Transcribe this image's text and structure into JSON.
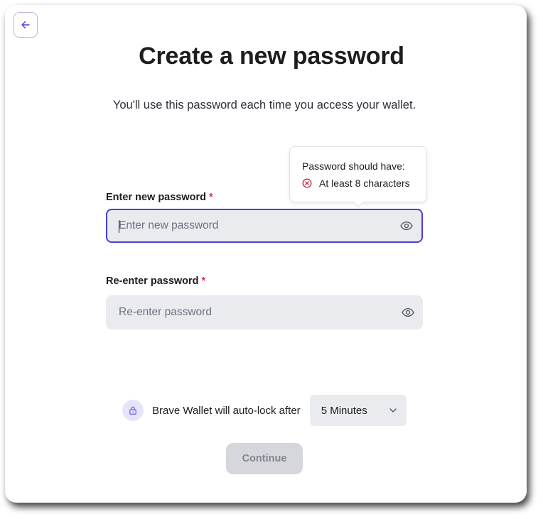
{
  "page": {
    "title": "Create a new password",
    "subtitle": "You'll use this password each time you access your wallet."
  },
  "navigation": {
    "back_icon": "arrow-left-icon"
  },
  "tooltip": {
    "heading": "Password should have:",
    "requirements": [
      {
        "label": "At least 8 characters",
        "status": "unmet",
        "icon": "close-circle-icon"
      }
    ]
  },
  "form": {
    "new_password": {
      "label": "Enter new password",
      "required_mark": "*",
      "placeholder": "Enter new password",
      "value": "",
      "focused": true,
      "toggle_icon": "eye-icon"
    },
    "confirm_password": {
      "label": "Re-enter password",
      "required_mark": "*",
      "placeholder": "Re-enter password",
      "value": "",
      "toggle_icon": "eye-icon"
    }
  },
  "autolock": {
    "icon": "lock-icon",
    "text": "Brave Wallet will auto-lock after",
    "selected": "5 Minutes",
    "dropdown_icon": "chevron-down-icon"
  },
  "actions": {
    "continue_label": "Continue",
    "continue_enabled": false
  },
  "colors": {
    "accent": "#4c3fd6",
    "error": "#d6304a",
    "field_bg": "#e9ebef",
    "disabled_button_bg": "#d5d7dc",
    "disabled_button_text": "#81868f"
  }
}
